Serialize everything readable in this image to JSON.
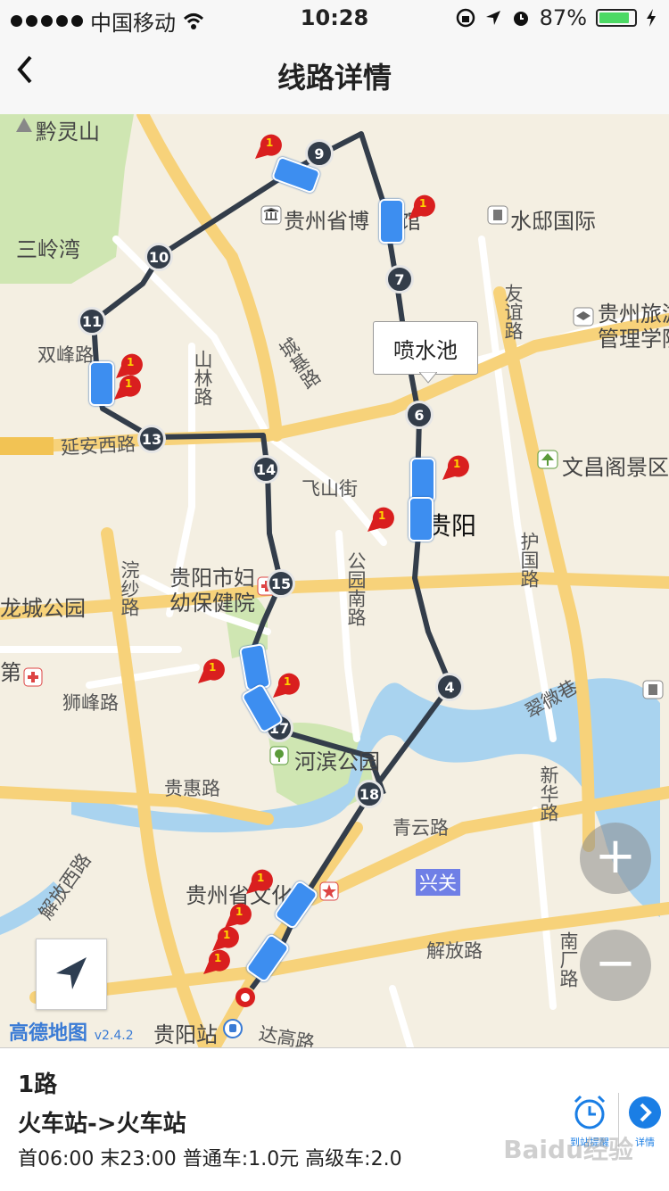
{
  "status_bar": {
    "carrier": "中国移动",
    "time": "10:28",
    "battery": "87%",
    "battery_fraction": 0.87
  },
  "nav": {
    "title": "线路详情"
  },
  "map": {
    "callout": "喷水池",
    "labels": {
      "qianlingshan": "黔灵山",
      "sanlingwan": "三岭湾",
      "museum": "贵州省博",
      "museum_end": "馆",
      "shuidi": "水邸国际",
      "youyi": "友谊路",
      "tourism1": "贵州旅游",
      "tourism2": "管理学院",
      "shuangfeng": "双峰路",
      "shanlin": "山林路",
      "chengji": "城基路",
      "yanan": "延安西路",
      "feishan": "飞山街",
      "wenchang": "文昌阁景区",
      "guiyang": "贵阳",
      "huguo": "护国路",
      "hospital1": "贵阳市妇",
      "hospital2": "幼保健院",
      "longcheng": "龙城公园",
      "gongyuan": "公园南路",
      "huansha": "浣纱路",
      "di": "第",
      "shifeng": "狮峰路",
      "cuiwei": "翠微巷",
      "hebin": "河滨公园",
      "guihui": "贵惠路",
      "qingyun": "青云路",
      "xinhua": "新华路",
      "xingguan": "兴关",
      "jiefangxi": "解放西路",
      "wenhua": "贵州省文化",
      "jiefang": "解放路",
      "nanchang": "南厂路",
      "guiyangzhan": "贵阳站",
      "dagao": "达高路"
    },
    "stops": [
      "4",
      "6",
      "7",
      "9",
      "10",
      "11",
      "13",
      "14",
      "15",
      "17",
      "18"
    ],
    "zoom_in": "+",
    "zoom_out": "−",
    "logo": "高德地图",
    "logo_version": "v2.4.2"
  },
  "route": {
    "name": "1路",
    "direction": "火车站->火车站",
    "schedule": "首06:00 末23:00 普通车:1.0元 高级车:2.0",
    "remind_label": "到站提醒",
    "detail_label": "详情",
    "watermark": "Baidu经验"
  },
  "colors": {
    "route_line": "#333d4a",
    "bus": "#3d8ef0",
    "pin": "#d91f1f",
    "road_major": "#f7d27a",
    "park": "#cfe6b2",
    "water": "#a9d3ef"
  }
}
